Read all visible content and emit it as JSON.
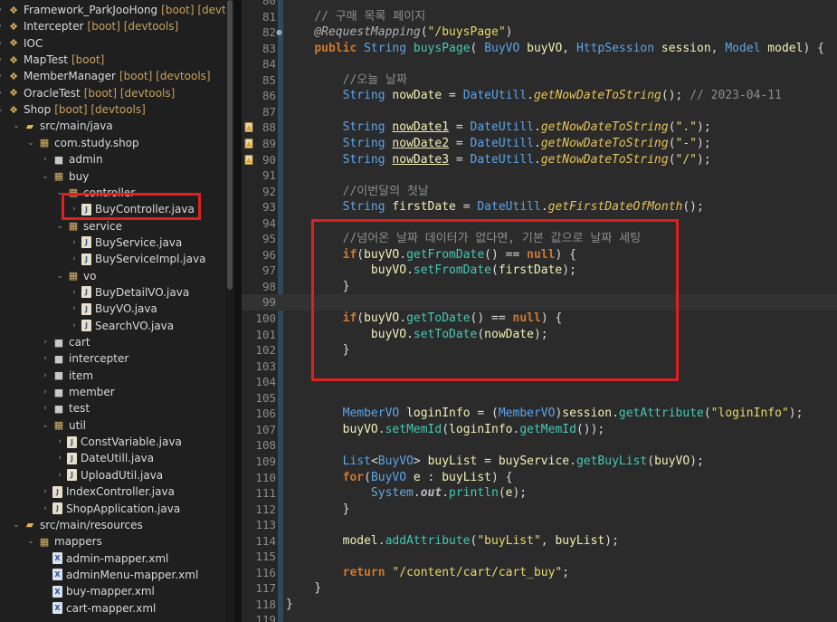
{
  "project_tree": [
    {
      "level": 0,
      "kind": "project",
      "label": "Framework_ParkJooHong",
      "decoration": "[boot] [devtools]"
    },
    {
      "level": 0,
      "kind": "project",
      "label": "Intercepter",
      "decoration": "[boot] [devtools]"
    },
    {
      "level": 0,
      "kind": "project",
      "label": "IOC",
      "decoration": ""
    },
    {
      "level": 0,
      "kind": "project",
      "label": "MapTest",
      "decoration": "[boot]"
    },
    {
      "level": 0,
      "kind": "project",
      "label": "MemberManager",
      "decoration": "[boot] [devtools]"
    },
    {
      "level": 0,
      "kind": "project",
      "label": "OracleTest",
      "decoration": "[boot] [devtools]"
    },
    {
      "level": 0,
      "kind": "project",
      "label": "Shop",
      "decoration": "[boot] [devtools]"
    },
    {
      "level": 1,
      "kind": "folder",
      "label": "src/main/java",
      "decoration": ""
    },
    {
      "level": 2,
      "kind": "package",
      "label": "com.study.shop",
      "decoration": ""
    },
    {
      "level": 3,
      "kind": "package",
      "label": "admin",
      "decoration": ""
    },
    {
      "level": 3,
      "kind": "package",
      "label": "buy",
      "decoration": ""
    },
    {
      "level": 4,
      "kind": "package",
      "label": "controller",
      "decoration": ""
    },
    {
      "level": 5,
      "kind": "java",
      "label": "BuyController.java",
      "decoration": ""
    },
    {
      "level": 4,
      "kind": "package",
      "label": "service",
      "decoration": ""
    },
    {
      "level": 5,
      "kind": "java",
      "label": "BuyService.java",
      "decoration": ""
    },
    {
      "level": 5,
      "kind": "java",
      "label": "BuyServiceImpl.java",
      "decoration": ""
    },
    {
      "level": 4,
      "kind": "package",
      "label": "vo",
      "decoration": ""
    },
    {
      "level": 5,
      "kind": "java",
      "label": "BuyDetailVO.java",
      "decoration": ""
    },
    {
      "level": 5,
      "kind": "java",
      "label": "BuyVO.java",
      "decoration": ""
    },
    {
      "level": 5,
      "kind": "java",
      "label": "SearchVO.java",
      "decoration": ""
    },
    {
      "level": 3,
      "kind": "package",
      "label": "cart",
      "decoration": ""
    },
    {
      "level": 3,
      "kind": "package",
      "label": "intercepter",
      "decoration": ""
    },
    {
      "level": 3,
      "kind": "package",
      "label": "item",
      "decoration": ""
    },
    {
      "level": 3,
      "kind": "package",
      "label": "member",
      "decoration": ""
    },
    {
      "level": 3,
      "kind": "package",
      "label": "test",
      "decoration": ""
    },
    {
      "level": 3,
      "kind": "package",
      "label": "util",
      "decoration": ""
    },
    {
      "level": 4,
      "kind": "java",
      "label": "ConstVariable.java",
      "decoration": ""
    },
    {
      "level": 4,
      "kind": "java",
      "label": "DateUtill.java",
      "decoration": ""
    },
    {
      "level": 4,
      "kind": "java",
      "label": "UploadUtil.java",
      "decoration": ""
    },
    {
      "level": 3,
      "kind": "java",
      "label": "IndexController.java",
      "decoration": ""
    },
    {
      "level": 3,
      "kind": "java",
      "label": "ShopApplication.java",
      "decoration": ""
    },
    {
      "level": 1,
      "kind": "folder",
      "label": "src/main/resources",
      "decoration": ""
    },
    {
      "level": 2,
      "kind": "package",
      "label": "mappers",
      "decoration": ""
    },
    {
      "level": 3,
      "kind": "xml",
      "label": "admin-mapper.xml",
      "decoration": ""
    },
    {
      "level": 3,
      "kind": "xml",
      "label": "adminMenu-mapper.xml",
      "decoration": ""
    },
    {
      "level": 3,
      "kind": "xml",
      "label": "buy-mapper.xml",
      "decoration": ""
    },
    {
      "level": 3,
      "kind": "xml",
      "label": "cart-mapper.xml",
      "decoration": ""
    }
  ],
  "code_lines": [
    {
      "n": "80",
      "t": []
    },
    {
      "n": "81",
      "t": [
        [
          "    ",
          ""
        ],
        [
          "// 구매 목록 페이지",
          "cm"
        ]
      ]
    },
    {
      "n": "82",
      "marker": "●",
      "t": [
        [
          "    ",
          ""
        ],
        [
          "@RequestMapping",
          "an"
        ],
        [
          "(",
          ""
        ],
        [
          "\"/buysPage\"",
          "st"
        ],
        [
          ")",
          ""
        ]
      ]
    },
    {
      "n": "83",
      "t": [
        [
          "    ",
          ""
        ],
        [
          "public",
          "kw"
        ],
        [
          " ",
          ""
        ],
        [
          "String",
          "ty"
        ],
        [
          " ",
          ""
        ],
        [
          "buysPage",
          "fn"
        ],
        [
          "( ",
          ""
        ],
        [
          "BuyVO",
          "ty"
        ],
        [
          " ",
          ""
        ],
        [
          "buyVO",
          "vr"
        ],
        [
          ", ",
          ""
        ],
        [
          "HttpSession",
          "ty"
        ],
        [
          " ",
          ""
        ],
        [
          "session",
          "vr"
        ],
        [
          ", ",
          ""
        ],
        [
          "Model",
          "ty"
        ],
        [
          " ",
          ""
        ],
        [
          "model",
          "vr"
        ],
        [
          ") {",
          ""
        ]
      ]
    },
    {
      "n": "84",
      "t": []
    },
    {
      "n": "85",
      "t": [
        [
          "        ",
          ""
        ],
        [
          "//오늘 날짜",
          "cm"
        ]
      ]
    },
    {
      "n": "86",
      "t": [
        [
          "        ",
          ""
        ],
        [
          "String",
          "ty"
        ],
        [
          " ",
          ""
        ],
        [
          "nowDate",
          "vr"
        ],
        [
          " = ",
          ""
        ],
        [
          "DateUtill",
          "ty"
        ],
        [
          ".",
          ""
        ],
        [
          "getNowDateToString",
          "fi"
        ],
        [
          "(); ",
          ""
        ],
        [
          "// 2023-04-11",
          "cm"
        ]
      ]
    },
    {
      "n": "87",
      "t": []
    },
    {
      "n": "88",
      "warn": true,
      "t": [
        [
          "        ",
          ""
        ],
        [
          "String",
          "ty"
        ],
        [
          " ",
          ""
        ],
        [
          "nowDate1",
          "vu"
        ],
        [
          " = ",
          ""
        ],
        [
          "DateUtill",
          "ty"
        ],
        [
          ".",
          ""
        ],
        [
          "getNowDateToString",
          "fi"
        ],
        [
          "(",
          ""
        ],
        [
          "\".\"",
          "st"
        ],
        [
          ");",
          ""
        ]
      ]
    },
    {
      "n": "89",
      "warn": true,
      "t": [
        [
          "        ",
          ""
        ],
        [
          "String",
          "ty"
        ],
        [
          " ",
          ""
        ],
        [
          "nowDate2",
          "vu"
        ],
        [
          " = ",
          ""
        ],
        [
          "DateUtill",
          "ty"
        ],
        [
          ".",
          ""
        ],
        [
          "getNowDateToString",
          "fi"
        ],
        [
          "(",
          ""
        ],
        [
          "\"-\"",
          "st"
        ],
        [
          ");",
          ""
        ]
      ]
    },
    {
      "n": "90",
      "warn": true,
      "t": [
        [
          "        ",
          ""
        ],
        [
          "String",
          "ty"
        ],
        [
          " ",
          ""
        ],
        [
          "nowDate3",
          "vu"
        ],
        [
          " = ",
          ""
        ],
        [
          "DateUtill",
          "ty"
        ],
        [
          ".",
          ""
        ],
        [
          "getNowDateToString",
          "fi"
        ],
        [
          "(",
          ""
        ],
        [
          "\"/\"",
          "st"
        ],
        [
          ");",
          ""
        ]
      ]
    },
    {
      "n": "91",
      "t": []
    },
    {
      "n": "92",
      "t": [
        [
          "        ",
          ""
        ],
        [
          "//이번달의 첫날",
          "cm"
        ]
      ]
    },
    {
      "n": "93",
      "t": [
        [
          "        ",
          ""
        ],
        [
          "String",
          "ty"
        ],
        [
          " ",
          ""
        ],
        [
          "firstDate",
          "vr"
        ],
        [
          " = ",
          ""
        ],
        [
          "DateUtill",
          "ty"
        ],
        [
          ".",
          ""
        ],
        [
          "getFirstDateOfMonth",
          "fi"
        ],
        [
          "();",
          ""
        ]
      ]
    },
    {
      "n": "94",
      "t": []
    },
    {
      "n": "95",
      "t": [
        [
          "        ",
          ""
        ],
        [
          "//넘어온 날짜 데이터가 없다면, 기본 값으로 날짜 세팅",
          "cm"
        ]
      ]
    },
    {
      "n": "96",
      "t": [
        [
          "        ",
          ""
        ],
        [
          "if",
          "kw"
        ],
        [
          "(",
          ""
        ],
        [
          "buyVO",
          "vr"
        ],
        [
          ".",
          ""
        ],
        [
          "getFromDate",
          "fn"
        ],
        [
          "() == ",
          ""
        ],
        [
          "null",
          "nl"
        ],
        [
          ") {",
          ""
        ]
      ]
    },
    {
      "n": "97",
      "t": [
        [
          "            ",
          ""
        ],
        [
          "buyVO",
          "vr"
        ],
        [
          ".",
          ""
        ],
        [
          "setFromDate",
          "fn"
        ],
        [
          "(",
          ""
        ],
        [
          "firstDate",
          "vr"
        ],
        [
          ");",
          ""
        ]
      ]
    },
    {
      "n": "98",
      "t": [
        [
          "        ",
          ""
        ],
        [
          "}",
          ""
        ]
      ]
    },
    {
      "n": "99",
      "current": true,
      "t": []
    },
    {
      "n": "100",
      "t": [
        [
          "        ",
          ""
        ],
        [
          "if",
          "kw"
        ],
        [
          "(",
          ""
        ],
        [
          "buyVO",
          "vr"
        ],
        [
          ".",
          ""
        ],
        [
          "getToDate",
          "fn"
        ],
        [
          "() == ",
          ""
        ],
        [
          "null",
          "nl"
        ],
        [
          ") {",
          ""
        ]
      ]
    },
    {
      "n": "101",
      "t": [
        [
          "            ",
          ""
        ],
        [
          "buyVO",
          "vr"
        ],
        [
          ".",
          ""
        ],
        [
          "setToDate",
          "fn"
        ],
        [
          "(",
          ""
        ],
        [
          "nowDate",
          "vr"
        ],
        [
          ");",
          ""
        ]
      ]
    },
    {
      "n": "102",
      "t": [
        [
          "        ",
          ""
        ],
        [
          "}",
          ""
        ]
      ]
    },
    {
      "n": "103",
      "t": []
    },
    {
      "n": "104",
      "t": []
    },
    {
      "n": "105",
      "t": []
    },
    {
      "n": "106",
      "t": [
        [
          "        ",
          ""
        ],
        [
          "MemberVO",
          "ty"
        ],
        [
          " ",
          ""
        ],
        [
          "loginInfo",
          "vr"
        ],
        [
          " = (",
          ""
        ],
        [
          "MemberVO",
          "ty"
        ],
        [
          ")",
          ""
        ],
        [
          "session",
          "vr"
        ],
        [
          ".",
          ""
        ],
        [
          "getAttribute",
          "fn"
        ],
        [
          "(",
          ""
        ],
        [
          "\"loginInfo\"",
          "st"
        ],
        [
          ");",
          ""
        ]
      ]
    },
    {
      "n": "107",
      "t": [
        [
          "        ",
          ""
        ],
        [
          "buyVO",
          "vr"
        ],
        [
          ".",
          ""
        ],
        [
          "setMemId",
          "fn"
        ],
        [
          "(",
          ""
        ],
        [
          "loginInfo",
          "vr"
        ],
        [
          ".",
          ""
        ],
        [
          "getMemId",
          "fn"
        ],
        [
          "());",
          ""
        ]
      ]
    },
    {
      "n": "108",
      "t": []
    },
    {
      "n": "109",
      "t": [
        [
          "        ",
          ""
        ],
        [
          "List",
          "ty"
        ],
        [
          "<",
          ""
        ],
        [
          "BuyVO",
          "ty"
        ],
        [
          "> ",
          ""
        ],
        [
          "buyList",
          "vr"
        ],
        [
          " = ",
          ""
        ],
        [
          "buyService",
          "vr"
        ],
        [
          ".",
          ""
        ],
        [
          "getBuyList",
          "fn"
        ],
        [
          "(",
          ""
        ],
        [
          "buyVO",
          "vr"
        ],
        [
          ");",
          ""
        ]
      ]
    },
    {
      "n": "110",
      "t": [
        [
          "        ",
          ""
        ],
        [
          "for",
          "kw"
        ],
        [
          "(",
          ""
        ],
        [
          "BuyVO",
          "ty"
        ],
        [
          " ",
          ""
        ],
        [
          "e",
          "vr"
        ],
        [
          " : ",
          ""
        ],
        [
          "buyList",
          "vr"
        ],
        [
          ") {",
          ""
        ]
      ]
    },
    {
      "n": "111",
      "t": [
        [
          "            ",
          ""
        ],
        [
          "System",
          "so"
        ],
        [
          ".",
          ""
        ],
        [
          "out",
          "fo"
        ],
        [
          ".",
          ""
        ],
        [
          "println",
          "fn"
        ],
        [
          "(",
          ""
        ],
        [
          "e",
          "vr"
        ],
        [
          ");",
          ""
        ]
      ]
    },
    {
      "n": "112",
      "t": [
        [
          "        ",
          ""
        ],
        [
          "}",
          ""
        ]
      ]
    },
    {
      "n": "113",
      "t": []
    },
    {
      "n": "114",
      "t": [
        [
          "        ",
          ""
        ],
        [
          "model",
          "vr"
        ],
        [
          ".",
          ""
        ],
        [
          "addAttribute",
          "fn"
        ],
        [
          "(",
          ""
        ],
        [
          "\"buyList\"",
          "st"
        ],
        [
          ", ",
          ""
        ],
        [
          "buyList",
          "vr"
        ],
        [
          ");",
          ""
        ]
      ]
    },
    {
      "n": "115",
      "t": []
    },
    {
      "n": "116",
      "t": [
        [
          "        ",
          ""
        ],
        [
          "return",
          "kw"
        ],
        [
          " ",
          ""
        ],
        [
          "\"/content/cart/cart_buy\"",
          "st"
        ],
        [
          ";",
          ""
        ]
      ]
    },
    {
      "n": "117",
      "t": [
        [
          "    ",
          ""
        ],
        [
          "}",
          ""
        ]
      ]
    },
    {
      "n": "118",
      "t": [
        [
          "}",
          ""
        ]
      ]
    },
    {
      "n": "119",
      "t": []
    }
  ],
  "colors": {
    "highlight_box": "#e02020",
    "keyword": "#cc7832",
    "type": "#5ea4e8",
    "string": "#e6d96e",
    "comment": "#8e8e8e"
  }
}
